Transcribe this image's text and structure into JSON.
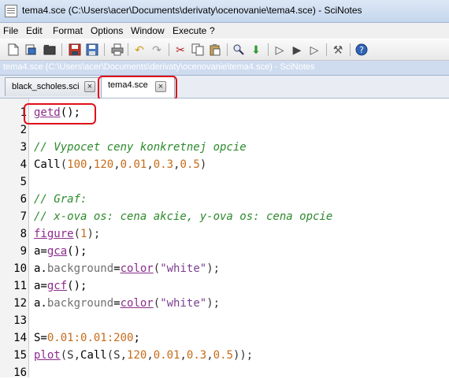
{
  "window": {
    "title": "tema4.sce (C:\\Users\\acer\\Documents\\derivaty\\ocenovanie\\tema4.sce) - SciNotes",
    "path": "tema4.sce (C:\\Users\\acer\\Documents\\derivaty\\ocenovanie\\tema4.sce) - SciNotes"
  },
  "menu": [
    "File",
    "Edit",
    "Format",
    "Options",
    "Window",
    "Execute",
    "?"
  ],
  "toolbar_icons": [
    "new-file-icon",
    "open-file-icon",
    "open-folder-icon",
    "save-icon",
    "save-as-icon",
    "print-icon",
    "undo-icon",
    "redo-icon",
    "cut-icon",
    "copy-icon",
    "paste-icon",
    "find-icon",
    "load-into-scilab-icon",
    "execute-icon",
    "execute-selection-icon",
    "execute-until-icon",
    "settings-icon",
    "help-icon"
  ],
  "tabs": [
    {
      "label": "black_scholes.sci",
      "active": false
    },
    {
      "label": "tema4.sce",
      "active": true
    }
  ],
  "line_numbers": [
    "1",
    "2",
    "3",
    "4",
    "5",
    "6",
    "7",
    "8",
    "9",
    "10",
    "11",
    "12",
    "13",
    "14",
    "15",
    "16"
  ],
  "code": {
    "l1_fn": "getd",
    "l1_rest": "();",
    "l3": "// Vypocet ceny konkretnej opcie",
    "l4_fn": "Call",
    "l4_open": "(",
    "l4_a": "100",
    "l4_b": "120",
    "l4_c": "0.01",
    "l4_d": "0.3",
    "l4_e": "0.5",
    "l4_close": ")",
    "l6": "// Graf:",
    "l7": "// x-ova os: cena akcie, y-ova os: cena opcie",
    "l8_fn": "figure",
    "l8_open": "(",
    "l8_a": "1",
    "l8_close": ");",
    "l9_a": "a=",
    "l9_fn": "gca",
    "l9_rest": "();",
    "l10_a": "a.",
    "l10_prop": "background",
    "l10_eq": "=",
    "l10_fn": "color",
    "l10_open": "(",
    "l10_str": "\"white\"",
    "l10_close": ");",
    "l11_a": "a=",
    "l11_fn": "gcf",
    "l11_rest": "();",
    "l12_a": "a.",
    "l12_prop": "background",
    "l12_eq": "=",
    "l12_fn": "color",
    "l12_open": "(",
    "l12_str": "\"white\"",
    "l12_close": ");",
    "l14_a": "S=",
    "l14_n1": "0.01",
    "l14_c1": ":",
    "l14_n2": "0.01",
    "l14_c2": ":",
    "l14_n3": "200",
    "l14_end": ";",
    "l15_fn": "plot",
    "l15_a": "(S,",
    "l15_call": "Call",
    "l15_b": "(S,",
    "l15_n1": "120",
    "l15_n2": "0.01",
    "l15_n3": "0.3",
    "l15_n4": "0.5",
    "l15_end": "));"
  }
}
